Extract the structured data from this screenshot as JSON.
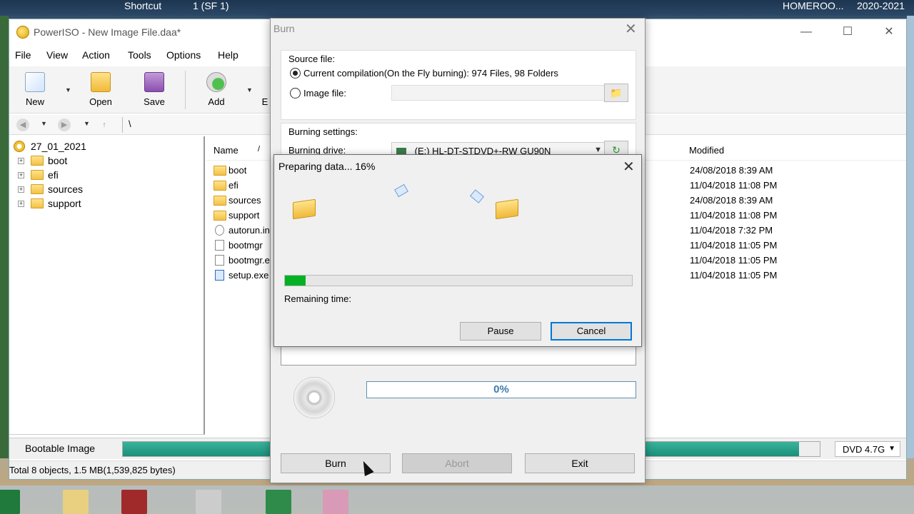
{
  "desktop": {
    "shortcut_label": "Shortcut",
    "sf_label": "1 (SF 1)",
    "homeroom_label": "HOMEROO...",
    "year_label": "2020-2021"
  },
  "main_window": {
    "title": "PowerISO - New Image File.daa*",
    "menu": [
      "File",
      "View",
      "Action",
      "Tools",
      "Options",
      "Help"
    ],
    "toolbar": {
      "new_label": "New",
      "open_label": "Open",
      "save_label": "Save",
      "add_label": "Add",
      "partial_label": "E"
    },
    "address": "\\",
    "tree": {
      "root": "27_01_2021",
      "items": [
        "boot",
        "efi",
        "sources",
        "support"
      ]
    },
    "list": {
      "col_name": "Name",
      "sort_indicator": "/",
      "col_modified": "Modified",
      "rows": [
        {
          "name": "boot",
          "modified": "24/08/2018 8:39 AM"
        },
        {
          "name": "efi",
          "modified": "11/04/2018 11:08 PM"
        },
        {
          "name": "sources",
          "modified": "24/08/2018 8:39 AM"
        },
        {
          "name": "support",
          "modified": "11/04/2018 11:08 PM"
        },
        {
          "name": "autorun.in",
          "modified": "11/04/2018 7:32 PM"
        },
        {
          "name": "bootmgr",
          "modified": "11/04/2018 11:05 PM"
        },
        {
          "name": "bootmgr.e",
          "modified": "11/04/2018 11:05 PM"
        },
        {
          "name": "setup.exe",
          "modified": "11/04/2018 11:05 PM"
        }
      ]
    },
    "status": {
      "image_type": "Bootable Image",
      "summary": "Total 8 objects, 1.5 MB(1,539,825 bytes)",
      "disc_type": "DVD 4.7G",
      "capacity_fill": 0.97
    }
  },
  "burn_dialog": {
    "title": "Burn",
    "source_label": "Source file:",
    "current_compilation_label": "Current compilation(On the Fly burning):  974 Files, 98 Folders",
    "image_file_label": "Image file:",
    "image_file_value": "",
    "settings_label": "Burning settings:",
    "drive_label": "Burning drive:",
    "drive_value": "(E:) HL-DT-STDVD+-RW GU90N",
    "progress_text": "0%",
    "burn_label": "Burn",
    "abort_label": "Abort",
    "exit_label": "Exit"
  },
  "progress_dialog": {
    "title": "Preparing data... 16%",
    "progress_fraction": 0.06,
    "remaining_label": "Remaining time:",
    "remaining_value": "",
    "pause_label": "Pause",
    "cancel_label": "Cancel"
  }
}
